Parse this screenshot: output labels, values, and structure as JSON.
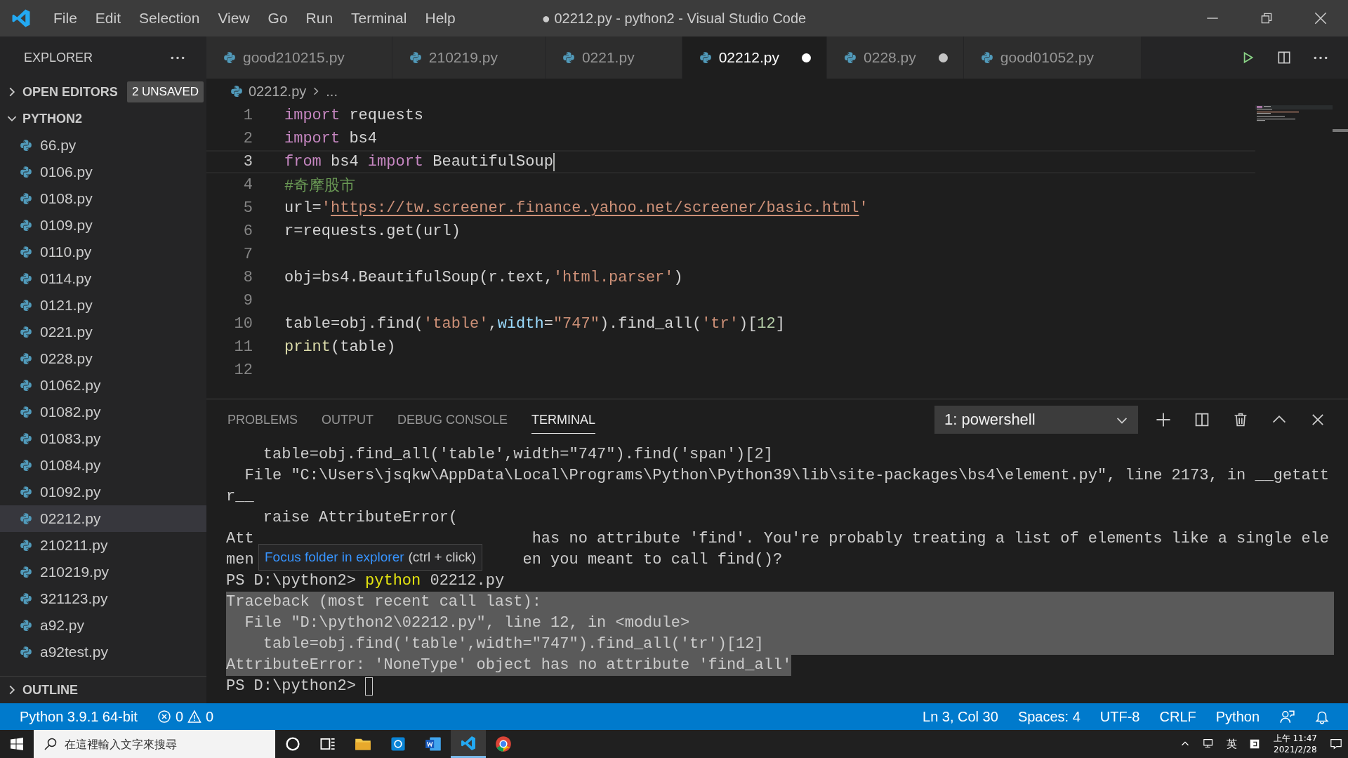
{
  "window": {
    "title": "● 02212.py - python2 - Visual Studio Code"
  },
  "menu": [
    "File",
    "Edit",
    "Selection",
    "View",
    "Go",
    "Run",
    "Terminal",
    "Help"
  ],
  "sidebar": {
    "title": "EXPLORER",
    "open_editors": {
      "label": "OPEN EDITORS",
      "badge": "2 UNSAVED",
      "expanded": false
    },
    "folder": {
      "label": "PYTHON2",
      "expanded": true,
      "items": [
        {
          "name": "66.py",
          "selected": false
        },
        {
          "name": "0106.py",
          "selected": false
        },
        {
          "name": "0108.py",
          "selected": false
        },
        {
          "name": "0109.py",
          "selected": false
        },
        {
          "name": "0110.py",
          "selected": false
        },
        {
          "name": "0114.py",
          "selected": false
        },
        {
          "name": "0121.py",
          "selected": false
        },
        {
          "name": "0221.py",
          "selected": false
        },
        {
          "name": "0228.py",
          "selected": false
        },
        {
          "name": "01062.py",
          "selected": false
        },
        {
          "name": "01082.py",
          "selected": false
        },
        {
          "name": "01083.py",
          "selected": false
        },
        {
          "name": "01084.py",
          "selected": false
        },
        {
          "name": "01092.py",
          "selected": false
        },
        {
          "name": "02212.py",
          "selected": true
        },
        {
          "name": "210211.py",
          "selected": false
        },
        {
          "name": "210219.py",
          "selected": false
        },
        {
          "name": "321123.py",
          "selected": false
        },
        {
          "name": "a92.py",
          "selected": false
        },
        {
          "name": "a92test.py",
          "selected": false
        }
      ]
    },
    "outline": {
      "label": "OUTLINE",
      "expanded": false
    }
  },
  "tabs": [
    {
      "label": "good210215.py",
      "selected": false,
      "dirty": false
    },
    {
      "label": "210219.py",
      "selected": false,
      "dirty": false
    },
    {
      "label": "0221.py",
      "selected": false,
      "dirty": false
    },
    {
      "label": "02212.py",
      "selected": true,
      "dirty": true
    },
    {
      "label": "0228.py",
      "selected": false,
      "dirty": true
    },
    {
      "label": "good01052.py",
      "selected": false,
      "dirty": false
    }
  ],
  "breadcrumb": {
    "file": "02212.py",
    "rest": "..."
  },
  "editor": {
    "lines": [
      {
        "number": "1",
        "current": false,
        "tokens": [
          {
            "kind": "keyword",
            "text": "import"
          },
          {
            "kind": "plain",
            "text": " requests"
          }
        ]
      },
      {
        "number": "2",
        "current": false,
        "tokens": [
          {
            "kind": "keyword",
            "text": "import"
          },
          {
            "kind": "plain",
            "text": " bs4"
          }
        ]
      },
      {
        "number": "3",
        "current": true,
        "tokens": [
          {
            "kind": "keyword",
            "text": "from"
          },
          {
            "kind": "plain",
            "text": " bs4 "
          },
          {
            "kind": "keyword",
            "text": "import"
          },
          {
            "kind": "plain",
            "text": " BeautifulSoup"
          }
        ]
      },
      {
        "number": "4",
        "current": false,
        "tokens": [
          {
            "kind": "comment",
            "text": "#奇摩股市"
          }
        ]
      },
      {
        "number": "5",
        "current": false,
        "tokens": [
          {
            "kind": "plain",
            "text": "url="
          },
          {
            "kind": "string",
            "text": "'"
          },
          {
            "kind": "link",
            "text": "https://tw.screener.finance.yahoo.net/screener/basic.html"
          },
          {
            "kind": "string",
            "text": "'"
          }
        ]
      },
      {
        "number": "6",
        "current": false,
        "tokens": [
          {
            "kind": "plain",
            "text": "r=requests.get(url)"
          }
        ]
      },
      {
        "number": "7",
        "current": false
      },
      {
        "number": "8",
        "current": false,
        "tokens": [
          {
            "kind": "plain",
            "text": "obj=bs4.BeautifulSoup(r.text,"
          },
          {
            "kind": "string",
            "text": "'html.parser'"
          },
          {
            "kind": "plain",
            "text": ")"
          }
        ]
      },
      {
        "number": "9",
        "current": false
      },
      {
        "number": "10",
        "current": false,
        "tokens": [
          {
            "kind": "plain",
            "text": "table=obj.find("
          },
          {
            "kind": "string",
            "text": "'table'"
          },
          {
            "kind": "plain",
            "text": ","
          },
          {
            "kind": "param",
            "text": "width"
          },
          {
            "kind": "plain",
            "text": "="
          },
          {
            "kind": "string",
            "text": "\"747\""
          },
          {
            "kind": "plain",
            "text": ").find_all("
          },
          {
            "kind": "string",
            "text": "'tr'"
          },
          {
            "kind": "plain",
            "text": ")["
          },
          {
            "kind": "number",
            "text": "12"
          },
          {
            "kind": "plain",
            "text": "]"
          }
        ]
      },
      {
        "number": "11",
        "current": false,
        "tokens": [
          {
            "kind": "function",
            "text": "print"
          },
          {
            "kind": "plain",
            "text": "(table)"
          }
        ]
      },
      {
        "number": "12",
        "current": false
      }
    ]
  },
  "panel": {
    "tabs": [
      {
        "label": "PROBLEMS",
        "selected": false
      },
      {
        "label": "OUTPUT",
        "selected": false
      },
      {
        "label": "DEBUG CONSOLE",
        "selected": false
      },
      {
        "label": "TERMINAL",
        "selected": true
      }
    ],
    "terminal_select": "1: powershell",
    "terminal": [
      {
        "kind": "text",
        "selected": false,
        "text": "    table=obj.find_all('table',width=\"747\").find('span')[2]"
      },
      {
        "kind": "text",
        "selected": false,
        "text": "  File \"C:\\Users\\jsqkw\\AppData\\Local\\Programs\\Python\\Python39\\lib\\site-packages\\bs4\\element.py\", line 2173, in __getatt"
      },
      {
        "kind": "text",
        "selected": false,
        "text": "r__"
      },
      {
        "kind": "text",
        "selected": false,
        "text": "    raise AttributeError("
      },
      {
        "kind": "covered",
        "selected": false,
        "text": "Att",
        "after": " has no attribute 'find'. You're probably treating a list of elements like a single ele"
      },
      {
        "kind": "covered",
        "selected": false,
        "text": "men",
        "after": "en you meant to call find()?"
      },
      {
        "kind": "prompt",
        "selected": false,
        "text": "PS D:\\python2> ",
        "command": "python",
        "args": " 02212.py"
      },
      {
        "kind": "text",
        "selected": true,
        "text": "Traceback (most recent call last):"
      },
      {
        "kind": "text",
        "selected": true,
        "text": "  File \"D:\\python2\\02212.py\", line 12, in <module>"
      },
      {
        "kind": "text",
        "selected": true,
        "text": "    table=obj.find('table',width=\"747\").find_all('tr')[12]"
      },
      {
        "kind": "text",
        "selected": true,
        "text": "AttributeError: 'NoneType' object has no attribute 'find_all'"
      },
      {
        "kind": "cursor",
        "selected": false,
        "text": "PS D:\\python2> "
      }
    ],
    "tooltip": {
      "link": "Focus folder in explorer",
      "hint": "(ctrl + click)"
    }
  },
  "status_bar": {
    "interpreter": "Python 3.9.1 64-bit",
    "errors": "0",
    "warnings": "0",
    "right": [
      "Ln 3, Col 30",
      "Spaces: 4",
      "UTF-8",
      "CRLF",
      "Python"
    ]
  },
  "taskbar": {
    "search": {
      "placeholder": "在這裡輸入文字來搜尋"
    },
    "apps": [
      {
        "kind": "cortana",
        "selected": false
      },
      {
        "kind": "taskview",
        "selected": false
      },
      {
        "kind": "folder",
        "selected": false
      },
      {
        "kind": "store",
        "selected": false
      },
      {
        "kind": "word",
        "selected": false
      },
      {
        "kind": "vscode",
        "selected": true
      },
      {
        "kind": "chrome",
        "selected": false
      }
    ],
    "ime": "英",
    "time": "上午 11:47",
    "date": "2021/2/28"
  }
}
